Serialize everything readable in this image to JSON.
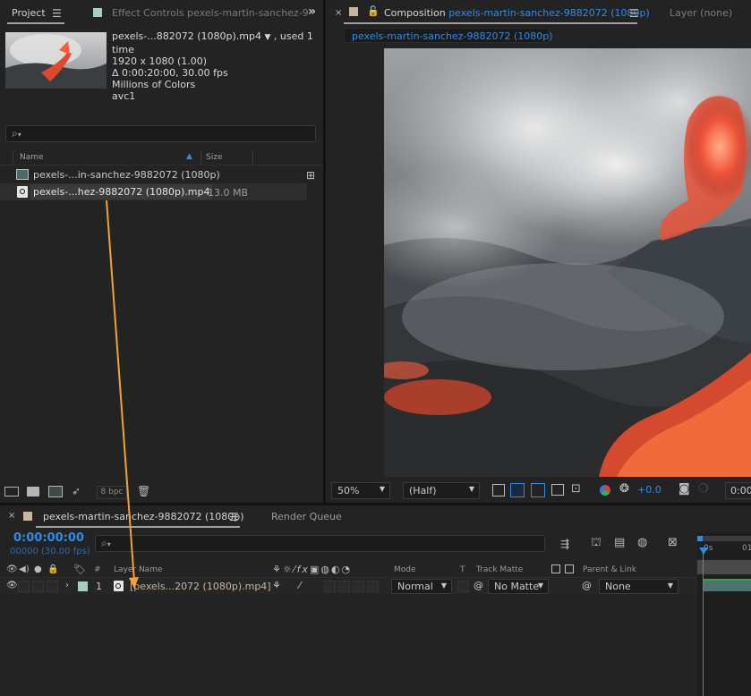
{
  "project": {
    "tab_project": "Project",
    "tab_effect": "Effect Controls",
    "tab_effect_target": "pexels-martin-sanchez-9",
    "footage": {
      "name": "pexels-...882072 (1080p).mp4",
      "used": ", used 1 time",
      "dimensions": "1920 x 1080 (1.00)",
      "duration": "Δ 0:00:20:00, 30.00 fps",
      "colors": "Millions of Colors",
      "codec": "avc1"
    },
    "columns": {
      "name": "Name",
      "size": "Size"
    },
    "items": [
      {
        "name": "pexels-...in-sanchez-9882072 (1080p)",
        "size": "",
        "type": "composition"
      },
      {
        "name": "pexels-...hez-9882072 (1080p).mp4",
        "size": "13.0 MB",
        "type": "footage"
      }
    ],
    "bpc": "8 bpc"
  },
  "composition": {
    "tab_label": "Composition",
    "comp_name": "pexels-martin-sanchez-9882072 (1080p)",
    "layer_tab": "Layer (none)",
    "sub_tab": "pexels-martin-sanchez-9882072 (1080p)",
    "zoom": "50%",
    "resolution": "(Half)",
    "exposure": "+0.0",
    "timecode_cut": "0:00"
  },
  "timeline": {
    "comp_tab": "pexels-martin-sanchez-9882072 (1080p)",
    "render_queue": "Render Queue",
    "timecode": "0:00:00:00",
    "frame_info": "00000 (30.00 fps)",
    "columns": {
      "number": "#",
      "layer_name": "Layer Name",
      "mode": "Mode",
      "t": "T",
      "track_matte": "Track Matte",
      "parent": "Parent & Link"
    },
    "layer": {
      "index": "1",
      "name": "[pexels...2072 (1080p).mp4]",
      "mode": "Normal",
      "matte": "No Matte",
      "parent": "None"
    },
    "ruler_labels": [
      "0s",
      "01"
    ]
  },
  "colors": {
    "accent": "#2d8ceb",
    "drag_arrow": "#f5a035",
    "label_color": "#a7cdc9"
  }
}
